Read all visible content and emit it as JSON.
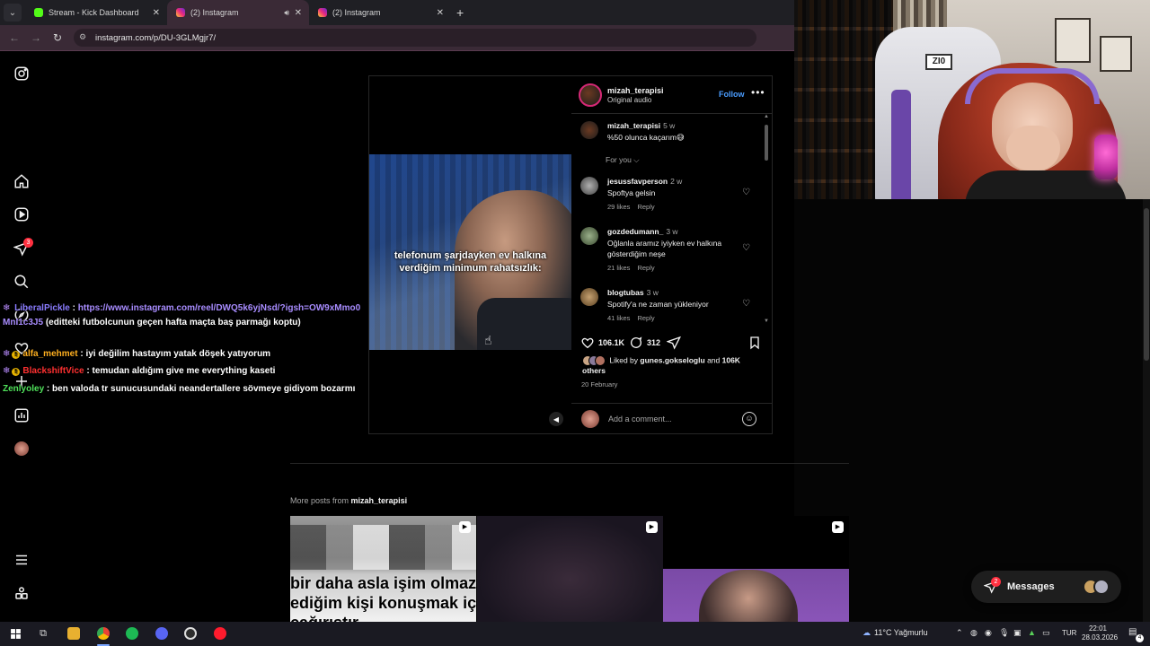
{
  "browser": {
    "tabs": [
      {
        "title": "Stream - Kick Dashboard",
        "icon": "kick-icon"
      },
      {
        "title": "(2) Instagram",
        "icon": "instagram-icon",
        "active": true
      },
      {
        "title": "(2) Instagram",
        "icon": "instagram-icon"
      }
    ],
    "url": "instagram.com/p/DU-3GLMgjr7/",
    "new_tab": "+"
  },
  "ig_nav": {
    "badge_count": "3"
  },
  "post": {
    "username": "mizah_terapisi",
    "audio": "Original audio",
    "follow_label": "Follow",
    "more": "•••",
    "video_caption": "telefonum şarjdayken ev halkına verdiğim minimum rahatsızlık:",
    "caption": {
      "username": "mizah_terapisi",
      "ago": "5 w",
      "text": "%50 olunca kaçarım😅"
    },
    "for_you": "For you ⌵",
    "comments": [
      {
        "username": "jesussfavperson",
        "ago": "2 w",
        "text": "Spoftya gelsin",
        "likes": "29 likes",
        "reply": "Reply"
      },
      {
        "username": "gozdedumann_",
        "ago": "3 w",
        "text": "Oğlanla aramız iyiyken ev halkına gösterdiğim neşe",
        "likes": "21 likes",
        "reply": "Reply"
      },
      {
        "username": "blogtubas",
        "ago": "3 w",
        "text": "Spotify'a ne zaman yükleniyor",
        "likes": "41 likes",
        "reply": "Reply"
      }
    ],
    "like_count": "106.1K",
    "comment_count": "312",
    "liked_by_prefix": "Liked by",
    "liked_by_user": "gunes.gokseloglu",
    "liked_by_and": "and",
    "liked_by_others": "106K others",
    "date": "20 February",
    "add_comment_placeholder": "Add a comment..."
  },
  "more_posts": {
    "prefix": "More posts from",
    "username": "mizah_terapisi",
    "thumb1_text_line1": "bir daha asla işim olmaz",
    "thumb1_text_line2": "ediğim kişi konuşmak içi",
    "thumb1_text_line3": "çağırıştır"
  },
  "messages": {
    "label": "Messages",
    "badge": "2"
  },
  "chat": [
    {
      "user": "LiberalPickle",
      "sep": ":",
      "link": "https://www.instagram.com/reel/DWQ5k6yjNsd/?igsh=OW9xMmo0MnI1c3J5",
      "msg": "(editteki futbolcunun geçen hafta maçta baş parmağı koptu)"
    },
    {
      "user": "alfa_mehmet",
      "sep": ":",
      "msg": "iyi değilim hastayım yatak döşek yatıyorum"
    },
    {
      "user": "BlackshiftVice",
      "sep": ":",
      "msg": "temudan aldığım give me everything kaseti"
    },
    {
      "user": "Zenlyoley",
      "sep": ":",
      "msg": "ben valoda tr sunucusundaki neandertallere sövmeye gidiyom bozarmı"
    }
  ],
  "webcam": {
    "chair_logo": "ZI0"
  },
  "taskbar": {
    "weather": "11°C  Yağmurlu",
    "lang": "TUR",
    "time": "22:01",
    "date": "28.03.2026",
    "notifications": "4"
  }
}
